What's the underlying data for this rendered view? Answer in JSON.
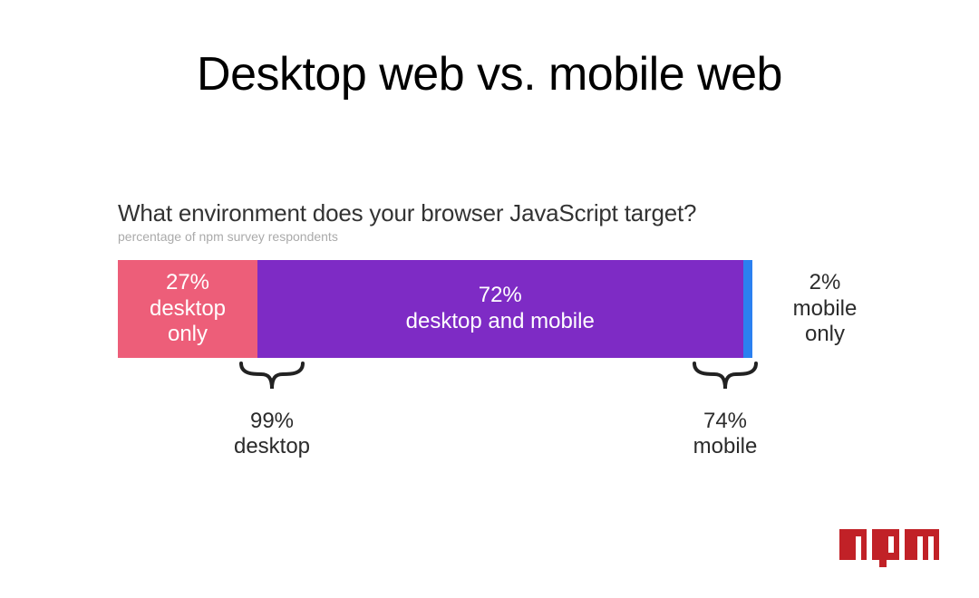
{
  "slide": {
    "title": "Desktop web vs. mobile web"
  },
  "chart_data": {
    "type": "bar",
    "title": "What environment does your browser JavaScript target?",
    "subtitle": "percentage of npm survey respondents",
    "categories": [
      "desktop only",
      "desktop and mobile",
      "mobile only"
    ],
    "values": [
      27,
      72,
      2
    ],
    "series": [
      {
        "name": "desktop only",
        "value": 27,
        "color": "#ed5e79"
      },
      {
        "name": "desktop and mobile",
        "value": 72,
        "color": "#7e2bc5"
      },
      {
        "name": "mobile only",
        "value": 2,
        "color": "#2b80f0"
      }
    ],
    "segment_labels": {
      "desktop_only_pct": "27%",
      "desktop_only_name": "desktop only",
      "both_pct": "72%",
      "both_name": "desktop and mobile",
      "mobile_only_pct": "2%",
      "mobile_only_name": "mobile only"
    },
    "annotations": {
      "desktop_total_pct": "99%",
      "desktop_total_label": "desktop",
      "mobile_total_pct": "74%",
      "mobile_total_label": "mobile"
    },
    "xlabel": "",
    "ylabel": "",
    "ylim": [
      0,
      100
    ]
  },
  "footer": {
    "logo": "npm"
  }
}
